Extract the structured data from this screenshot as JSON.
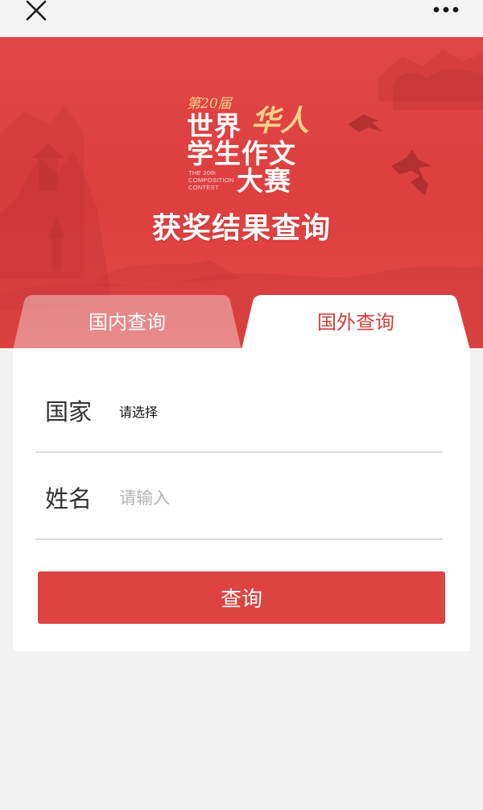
{
  "nav": {
    "close_icon": "close-icon",
    "more_icon": "more-options-icon"
  },
  "banner": {
    "logo": {
      "edition": "第20届",
      "line1": "世界",
      "accent": "华人",
      "line2": "学生作文",
      "line3": "大赛",
      "english": [
        "THE 20th",
        "COMPOSITION",
        "CONTEST"
      ]
    },
    "title": "获奖结果查询",
    "color": "#de3f3f"
  },
  "tabs": [
    {
      "label": "国内查询",
      "active": false
    },
    {
      "label": "国外查询",
      "active": true
    }
  ],
  "form": {
    "country": {
      "label": "国家",
      "value": "请选择"
    },
    "name": {
      "label": "姓名",
      "placeholder": "请输入"
    },
    "submit_label": "查询"
  },
  "colors": {
    "accent": "#dd4341",
    "active_tab_text": "#d2403a",
    "background": "#f2f2f2"
  }
}
